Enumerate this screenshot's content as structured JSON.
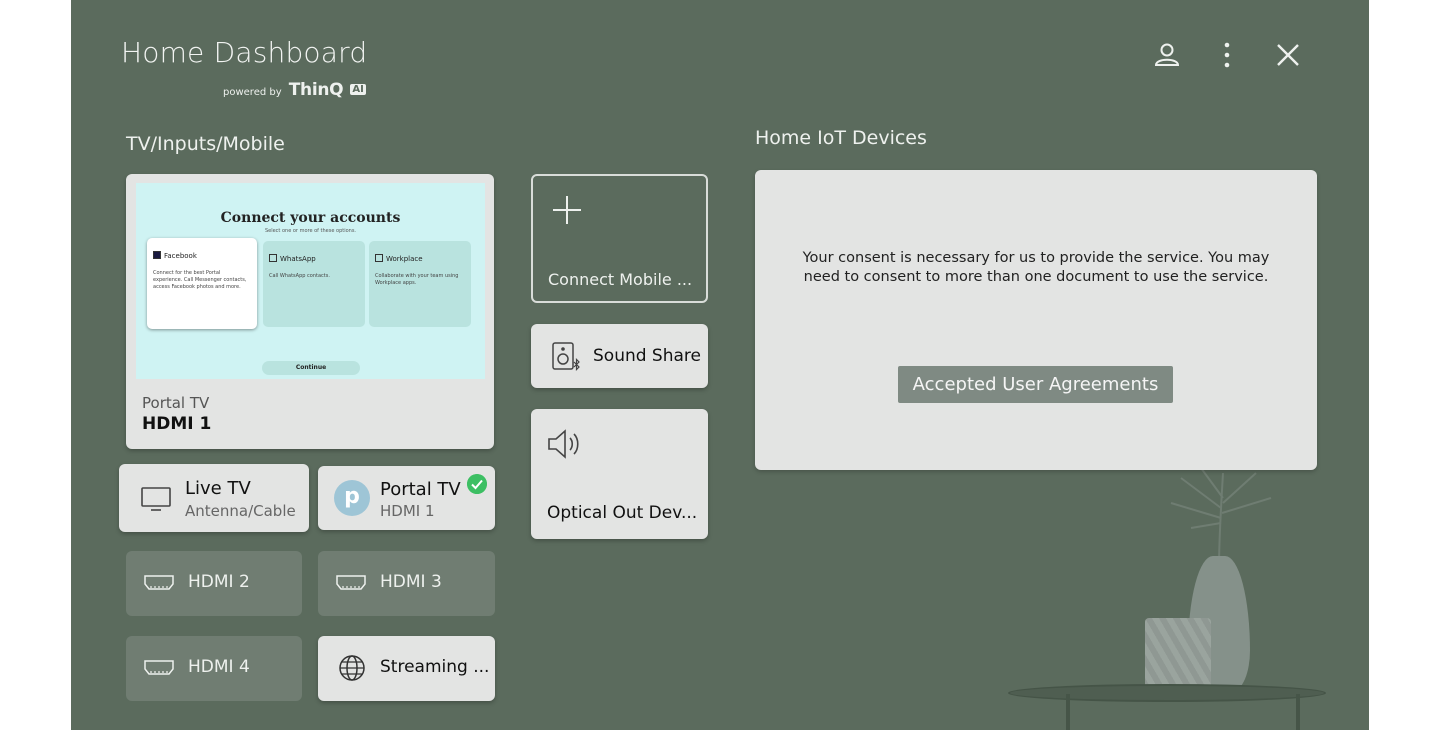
{
  "header": {
    "title": "Home Dashboard",
    "powered_by": "powered by",
    "brand": "ThinQ",
    "brand_badge": "AI"
  },
  "icons": {
    "user": "user-icon",
    "more": "more-vertical-icon",
    "close": "close-icon"
  },
  "tv_section": {
    "label": "TV/Inputs/Mobile",
    "preview": {
      "screen_title": "Connect your accounts",
      "screen_subtitle": "Select one or more of these options.",
      "options": [
        {
          "name": "Facebook",
          "desc": "Connect for the best Portal experience. Call Messenger contacts, access Facebook photos and more."
        },
        {
          "name": "WhatsApp",
          "desc": "Call WhatsApp contacts."
        },
        {
          "name": "Workplace",
          "desc": "Collaborate with your team using Workplace apps."
        }
      ],
      "continue_label": "Continue",
      "source_name": "Portal TV",
      "source_input": "HDMI 1"
    },
    "inputs": [
      {
        "name": "Live TV",
        "sub": "Antenna/Cable",
        "icon": "tv-icon"
      },
      {
        "name": "Portal TV",
        "sub": "HDMI 1",
        "avatar": "p",
        "selected": true
      },
      {
        "name": "HDMI 2",
        "icon": "hdmi-icon"
      },
      {
        "name": "HDMI 3",
        "icon": "hdmi-icon"
      },
      {
        "name": "HDMI 4",
        "icon": "hdmi-icon"
      },
      {
        "name": "Streaming ...",
        "icon": "globe-icon"
      }
    ],
    "devices": [
      {
        "name": "Connect Mobile ...",
        "icon": "plus-icon"
      },
      {
        "name": "Sound Share",
        "icon": "speaker-bluetooth-icon"
      },
      {
        "name": "Optical Out Dev...",
        "icon": "volume-icon"
      }
    ]
  },
  "iot_section": {
    "label": "Home IoT Devices",
    "consent_text": "Your consent is necessary for us to provide the service. You may need to consent to more than one document to use the service.",
    "agreements_button": "Accepted User Agreements"
  },
  "colors": {
    "background": "#5b6b5d",
    "tile_light": "#e3e4e3",
    "tile_dark": "#707d72",
    "check": "#3cbf63",
    "button": "#7f8a83"
  }
}
